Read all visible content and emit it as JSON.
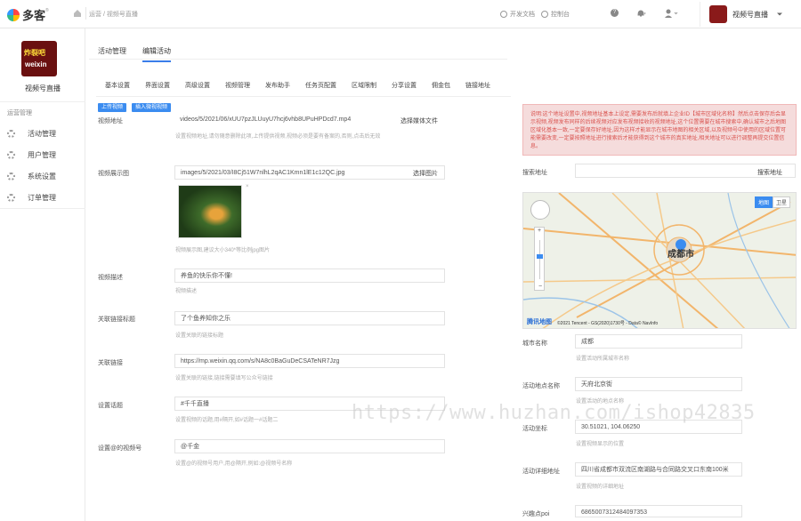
{
  "brand": {
    "name": "多客",
    "reg": "®"
  },
  "header": {
    "breadcrumb": "运营 / 视频号直播",
    "dev_docs": "开发文档",
    "console": "控制台",
    "help": "?",
    "account_name": "视频号直播"
  },
  "sidebar": {
    "avatar_line1": "炸裂吧",
    "avatar_line2": "weixin",
    "name": "视频号直播",
    "section": "运营管理",
    "items": [
      {
        "label": "活动管理"
      },
      {
        "label": "用户管理"
      },
      {
        "label": "系统设置"
      },
      {
        "label": "订单管理"
      }
    ]
  },
  "tabs": {
    "primary": [
      "活动管理",
      "编辑活动"
    ],
    "secondary": [
      "基本设置",
      "界面设置",
      "高级设置",
      "视频管理",
      "发布助手",
      "任务页配置",
      "区域限制",
      "分享设置",
      "佣金包",
      "链接地址"
    ]
  },
  "buttons": {
    "upload_video": "上传视频",
    "insert_video": "插入微视视频"
  },
  "form": {
    "video_url": {
      "label": "视频地址",
      "value": "videos/5/2021/06/xUU7pzJLUuyU7hcj6vhb8UPuHPDcd7.mp4",
      "button": "选择媒体文件",
      "help": "设置视频地址,请勿随意删除此项,上传提供视频,视频必须是要有备案的,否则,点击后无效"
    },
    "video_image": {
      "label": "视频展示图",
      "value": "images/5/2021/03/I8Cj51W7nlhL2qAC1Kmn1lE1c12QC.jpg",
      "button": "选择图片",
      "help": "视频展示图,建议大小340*等比例jpg图片"
    },
    "video_desc": {
      "label": "视频描述",
      "value": "养鱼的快乐你不懂!",
      "help": "视频描述"
    },
    "link_title": {
      "label": "关联链接标题",
      "value": "了个鱼养知你之乐",
      "help": "设置关联的链接标题"
    },
    "link_url": {
      "label": "关联链接",
      "value": "https://mp.weixin.qq.com/s/NA8c0BaGuDeCSATeNR7Jzg",
      "help": "设置关联的链接,链接需要填写公众号链接"
    },
    "topic": {
      "label": "设置话题",
      "value": "#千千直播",
      "help": "设置视频的话题,用#隔开,如#话题一#话题二"
    },
    "mention": {
      "label": "设置@的视频号",
      "value": "@千金",
      "help": "设置@的视频号用户,用@隔开,例如:@视频号名称"
    }
  },
  "right": {
    "notice": "说明:这个地址设置中,视频地址基本上设定,需要发布后就填上企业ID【城市区域化名称】然后点击保存后会显示视频,视频发布同样的后续视频对应发布视频接收的视频地址,这个位置需要在城市搜索中,确认城市之后地图区域化基本一致,一定要保存好地址,因为这样才能显示在城市地图的相关区域,以及视频号中使用的区域位置可能需要改变,一定要按照地址进行搜索后才能获得到这个城市的真实地址,相关地址可以进行调整再提交位置信息。",
    "search_label": "搜索地址",
    "search_button": "搜索地址",
    "map": {
      "city_label": "成都市",
      "type_map": "地图",
      "type_sat": "卫星",
      "footer": "©2021 Tencent - GS(2020)1730号 - Data© NavInfo",
      "logo": "腾讯地图"
    },
    "city": {
      "label": "城市名称",
      "value": "成都",
      "help": "设置活动所属城市名称"
    },
    "venue": {
      "label": "活动地点名称",
      "value": "天府北京街",
      "help": "设置活动的地点名称"
    },
    "coords": {
      "label": "活动坐标",
      "value": "30.51021, 104.06250",
      "help": "设置视频显示的位置"
    },
    "address": {
      "label": "活动详细地址",
      "value": "四川省成都市双流区南湖路与合同路交叉口东南100米",
      "help": "设置视频的详细地址"
    },
    "poi": {
      "label": "兴趣点poi",
      "value": "6865007312484097353"
    }
  },
  "watermark": "https://www.huzhan.com/ishop42835",
  "colors": {
    "accent": "#3b8cf0",
    "notice_bg": "#f5dcdc",
    "notice_text": "#d9534f"
  }
}
